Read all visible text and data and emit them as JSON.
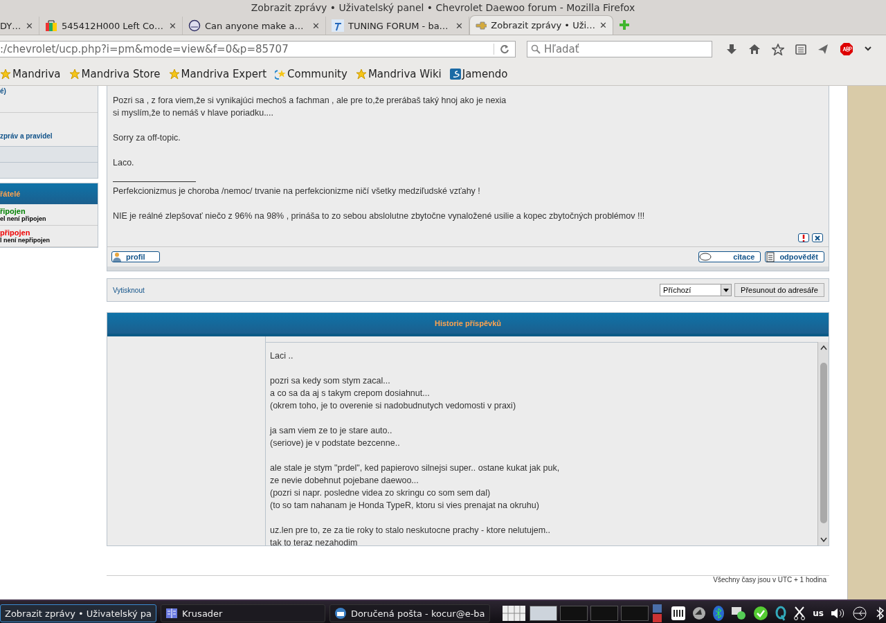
{
  "window": {
    "title": "Zobrazit zprávy • Uživatelský panel • Chevrolet Daewoo forum - Mozilla Firefox"
  },
  "tab_close": "✕",
  "tabs": [
    {
      "label": "DY…",
      "selected": false,
      "kind": "cut"
    },
    {
      "label": "545412H000 Left Co…",
      "selected": false,
      "kind": "shop"
    },
    {
      "label": "Can anyone make a…",
      "selected": false,
      "kind": "globe"
    },
    {
      "label": "TUNING FORUM - ba…",
      "selected": false,
      "kind": "tuning"
    },
    {
      "label": "Zobrazit zprávy • Uži…",
      "selected": true,
      "kind": "chevy"
    }
  ],
  "address_bar": {
    "url": ":/chevrolet/ucp.php?i=pm&mode=view&f=0&p=85707"
  },
  "search": {
    "placeholder": "Hľadať"
  },
  "bookmarks": [
    {
      "label": "Mandriva",
      "kind": "star"
    },
    {
      "label": "Mandriva Store",
      "kind": "star"
    },
    {
      "label": "Mandriva Expert",
      "kind": "star"
    },
    {
      "label": "Community",
      "kind": "community"
    },
    {
      "label": "Mandriva Wiki",
      "kind": "star"
    },
    {
      "label": "Jamendo",
      "kind": "jamendo"
    }
  ],
  "sidebar": {
    "link_top": "é)",
    "link_rules": "zpráv a pravidel",
    "friends_header": "řátelé",
    "friends": [
      {
        "status": "řipojen",
        "text": "el není připojen",
        "online": true
      },
      {
        "status": "připojen",
        "text": "l není nepřipojen",
        "online": false
      }
    ]
  },
  "post": {
    "paragraphs": [
      "Pozri sa , z fora viem,že si vynikajúci mechoš a fachman , ale pre to,že prerábaš taký hnoj ako je nexia\nsi myslím,že to nemáš v hlave poriadku....",
      "Sorry za off-topic.",
      "Laco."
    ],
    "signature": [
      "Perfekcionizmus je choroba /nemoc/ trvanie na perfekcionizme ničí všetky medziľudské vzťahy !",
      "NIE je reálné zlepšovať niečo z 96% na 98% , prináša to zo sebou abslolutne zbytočne vynaložené usilie a kopec zbytočných problémov !!!"
    ],
    "profile_button": "profil",
    "quote_button": "citace",
    "reply_button": "odpovědět"
  },
  "actions": {
    "print_link": "Vytisknout",
    "folder": "Příchozí",
    "move_button": "Přesunout do adresáře"
  },
  "history": {
    "title": "Historie příspěvků",
    "paragraphs": [
      "Laci ..",
      "pozri sa kedy som stym zacal...\na co sa da aj s takym crepom dosiahnut...\n(okrem toho, je to overenie si nadobudnutych vedomosti v praxi)",
      "ja sam viem ze to je stare auto..\n(seriove) je v podstate bezcenne..",
      "ale stale je stym \"prdel\", ked papierovo silnejsi super.. ostane kukat jak puk,\nze nevie dobehnut pojebane daewoo...\n(pozri si napr. posledne videa zo skringu co som sem dal)\n(to so tam nahanam je Honda TypeR, ktoru si vies prenajat na okruhu)",
      "uz.len pre to, ze za tie roky to stalo neskutocne prachy - ktore nelutujem..\ntak to teraz nezahodim"
    ]
  },
  "footer": "Všechny časy jsou v UTC + 1 hodina",
  "taskbar": {
    "tasks": [
      {
        "label": "Zobrazit zprávy • Uživatelský pa",
        "selected": true,
        "kind": "firefox"
      },
      {
        "label": "Krusader",
        "selected": false,
        "kind": "krusader"
      },
      {
        "label": "Doručená pošta - kocur@e-ba",
        "selected": false,
        "kind": "mail"
      }
    ],
    "desktops": [
      {
        "selected": true
      },
      {
        "selected": false
      },
      {
        "selected": false
      },
      {
        "selected": false
      }
    ],
    "keyboard_layout": "us"
  }
}
